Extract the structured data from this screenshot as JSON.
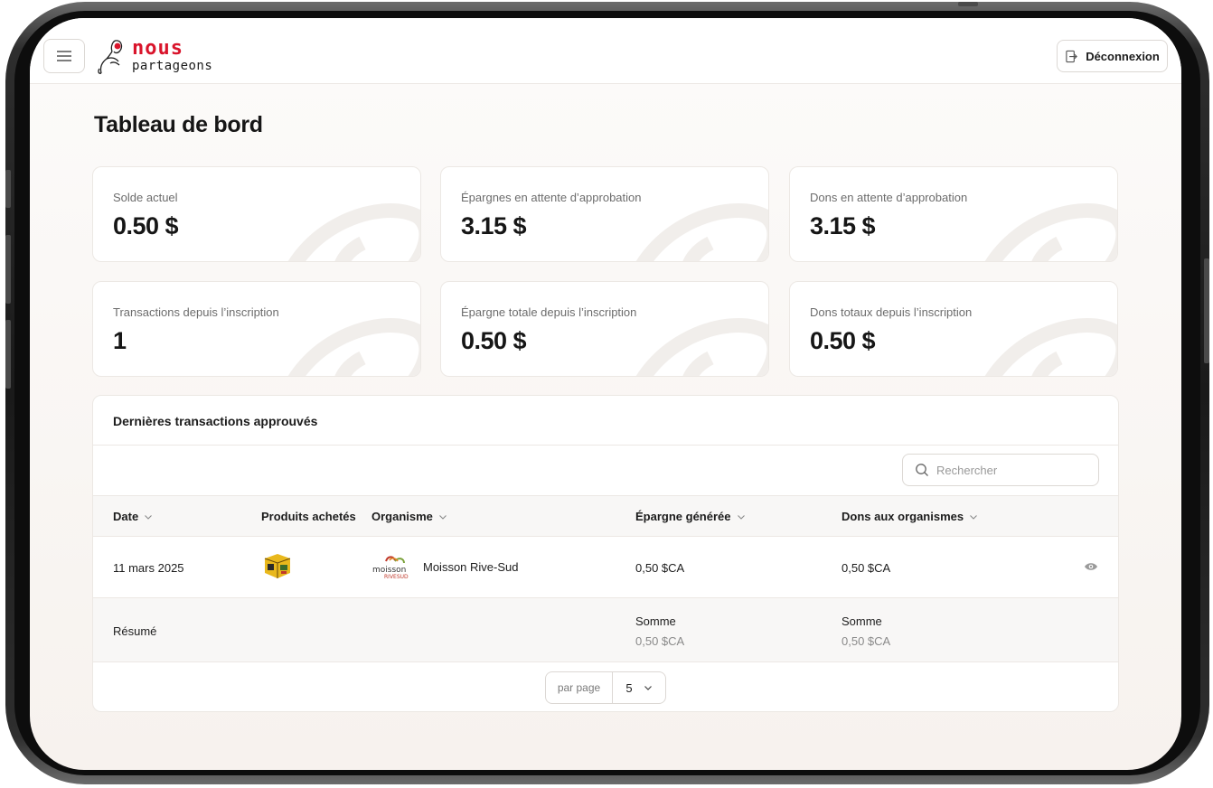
{
  "header": {
    "logo_primary": "nous",
    "logo_secondary": "partageons",
    "logout_label": "Déconnexion",
    "brand_color": "#d9142b"
  },
  "page": {
    "title": "Tableau de bord"
  },
  "stats": [
    {
      "label": "Solde actuel",
      "value": "0.50 $"
    },
    {
      "label": "Épargnes en attente d’approbation",
      "value": "3.15 $"
    },
    {
      "label": "Dons en attente d’approbation",
      "value": "3.15 $"
    },
    {
      "label": "Transactions depuis l’inscription",
      "value": "1"
    },
    {
      "label": "Épargne totale depuis l’inscription",
      "value": "0.50 $"
    },
    {
      "label": "Dons totaux depuis l’inscription",
      "value": "0.50 $"
    }
  ],
  "transactions": {
    "title": "Dernières transactions approuvés",
    "search_placeholder": "Rechercher",
    "columns": {
      "date": "Date",
      "products": "Produits achetés",
      "organization": "Organisme",
      "savings": "Épargne générée",
      "donations": "Dons aux organismes"
    },
    "rows": [
      {
        "date": "11 mars 2025",
        "organization": "Moisson Rive-Sud",
        "savings": "0,50 $CA",
        "donations": "0,50 $CA"
      }
    ],
    "summary": {
      "label": "Résumé",
      "savings_label": "Somme",
      "savings_value": "0,50 $CA",
      "donations_label": "Somme",
      "donations_value": "0,50 $CA"
    },
    "pagination": {
      "per_page_label": "par page",
      "per_page_value": "5"
    }
  },
  "icons": {
    "menu": "hamburger-icon",
    "logout": "logout-icon",
    "search": "search-icon",
    "sort": "chevron-down-icon",
    "view": "eye-icon"
  }
}
